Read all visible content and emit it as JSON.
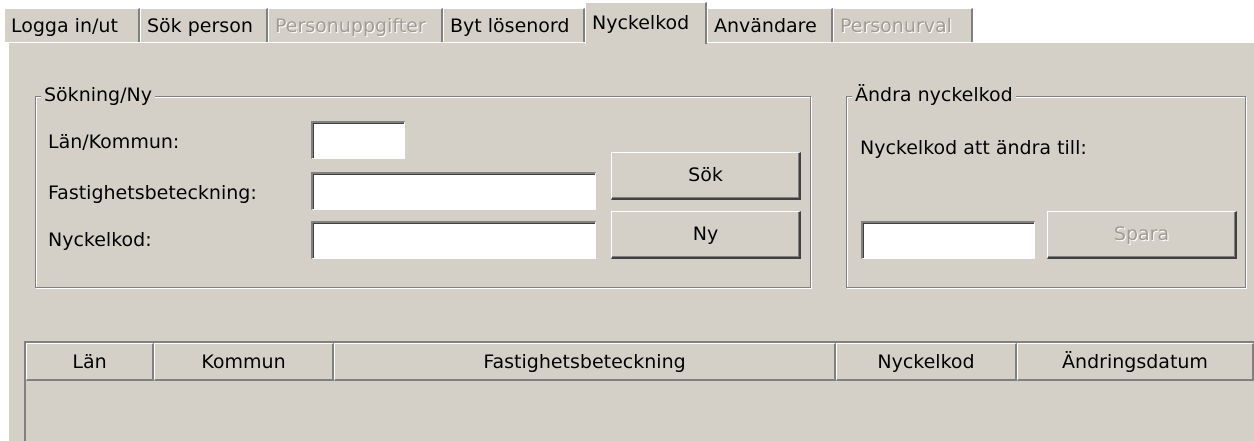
{
  "tabs": [
    {
      "label": "Logga in/ut",
      "state": "normal"
    },
    {
      "label": "Sök person",
      "state": "normal"
    },
    {
      "label": "Personuppgifter",
      "state": "disabled"
    },
    {
      "label": "Byt lösenord",
      "state": "normal"
    },
    {
      "label": "Nyckelkod",
      "state": "active"
    },
    {
      "label": "Användare",
      "state": "normal"
    },
    {
      "label": "Personurval",
      "state": "disabled"
    }
  ],
  "search_group": {
    "legend": "Sökning/Ny",
    "lan_kommun_label": "Län/Kommun:",
    "lan_kommun_value": "",
    "fastighet_label": "Fastighetsbeteckning:",
    "fastighet_value": "",
    "nyckelkod_label": "Nyckelkod:",
    "nyckelkod_value": "",
    "search_button": "Sök",
    "new_button": "Ny"
  },
  "change_group": {
    "legend": "Ändra nyckelkod",
    "prompt": "Nyckelkod att ändra till:",
    "new_code_value": "",
    "save_button": "Spara"
  },
  "results_table": {
    "columns": [
      "Län",
      "Kommun",
      "Fastighetsbeteckning",
      "Nyckelkod",
      "Ändringsdatum"
    ],
    "rows": []
  },
  "colors": {
    "face": "#d4d0c8",
    "shadow": "#808080",
    "highlight": "#ffffff",
    "disabled_text": "#a09c94"
  }
}
